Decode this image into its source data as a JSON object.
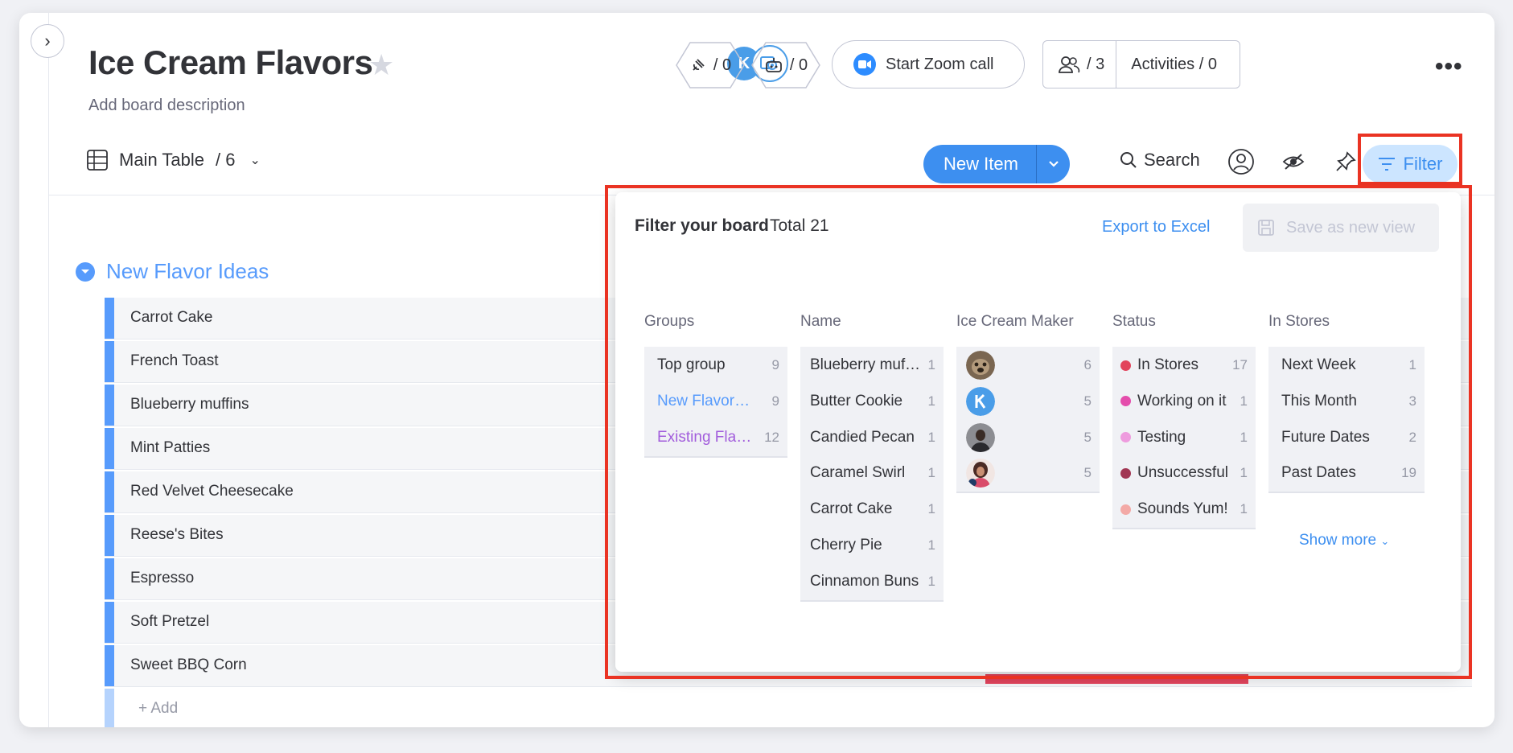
{
  "board": {
    "title": "Ice Cream Flavors",
    "description": "Add board description"
  },
  "header": {
    "avatar_initial": "K",
    "integrations_count": "/ 0",
    "automations_count": "/ 0",
    "zoom_label": "Start Zoom call",
    "members_count": "/ 3",
    "activities_label": "Activities / 0",
    "more_label": "•••"
  },
  "toolbar": {
    "view_name": "Main Table",
    "view_count": "/ 6",
    "new_item_label": "New Item",
    "search_label": "Search",
    "filter_label": "Filter"
  },
  "group": {
    "name": "New Flavor Ideas",
    "color": "#579bfc",
    "items": [
      "Carrot Cake",
      "French Toast",
      "Blueberry muffins",
      "Mint Patties",
      "Red Velvet Cheesecake",
      "Reese's Bites",
      "Espresso",
      "Soft Pretzel",
      "Sweet BBQ Corn"
    ],
    "add_label": "+ Add"
  },
  "filter_panel": {
    "title": "Filter your board",
    "total": "Total 21",
    "export_label": "Export to Excel",
    "save_view_label": "Save as new view",
    "show_more_label": "Show more",
    "columns": {
      "groups": {
        "header": "Groups",
        "options": [
          {
            "label": "Top group",
            "count": "9",
            "color": "#323338"
          },
          {
            "label": "New Flavor Ideas",
            "count": "9",
            "color": "#579bfc"
          },
          {
            "label": "Existing Flavors",
            "count": "12",
            "color": "#a25ddc"
          }
        ]
      },
      "name": {
        "header": "Name",
        "options": [
          {
            "label": "Blueberry muffins",
            "count": "1"
          },
          {
            "label": "Butter Cookie",
            "count": "1"
          },
          {
            "label": "Candied Pecan",
            "count": "1"
          },
          {
            "label": "Caramel Swirl",
            "count": "1"
          },
          {
            "label": "Carrot Cake",
            "count": "1"
          },
          {
            "label": "Cherry Pie",
            "count": "1"
          },
          {
            "label": "Cinnamon Buns",
            "count": "1"
          }
        ]
      },
      "maker": {
        "header": "Ice Cream Maker",
        "options": [
          {
            "avatar": "dog-photo",
            "count": "6"
          },
          {
            "avatar": "K",
            "count": "5"
          },
          {
            "avatar": "person-photo",
            "count": "5"
          },
          {
            "avatar": "person-photo-2",
            "count": "5"
          }
        ]
      },
      "status": {
        "header": "Status",
        "options": [
          {
            "label": "In Stores",
            "count": "17",
            "color": "#e2445c"
          },
          {
            "label": "Working on it",
            "count": "1",
            "color": "#e44dac"
          },
          {
            "label": "Testing",
            "count": "1",
            "color": "#ee9bde"
          },
          {
            "label": "Unsuccessful",
            "count": "1",
            "color": "#a13653"
          },
          {
            "label": "Sounds Yum!",
            "count": "1",
            "color": "#f3a9a6"
          }
        ]
      },
      "in_stores": {
        "header": "In Stores",
        "options": [
          {
            "label": "Next Week",
            "count": "1"
          },
          {
            "label": "This Month",
            "count": "3"
          },
          {
            "label": "Future Dates",
            "count": "2"
          },
          {
            "label": "Past Dates",
            "count": "19"
          }
        ]
      }
    }
  }
}
